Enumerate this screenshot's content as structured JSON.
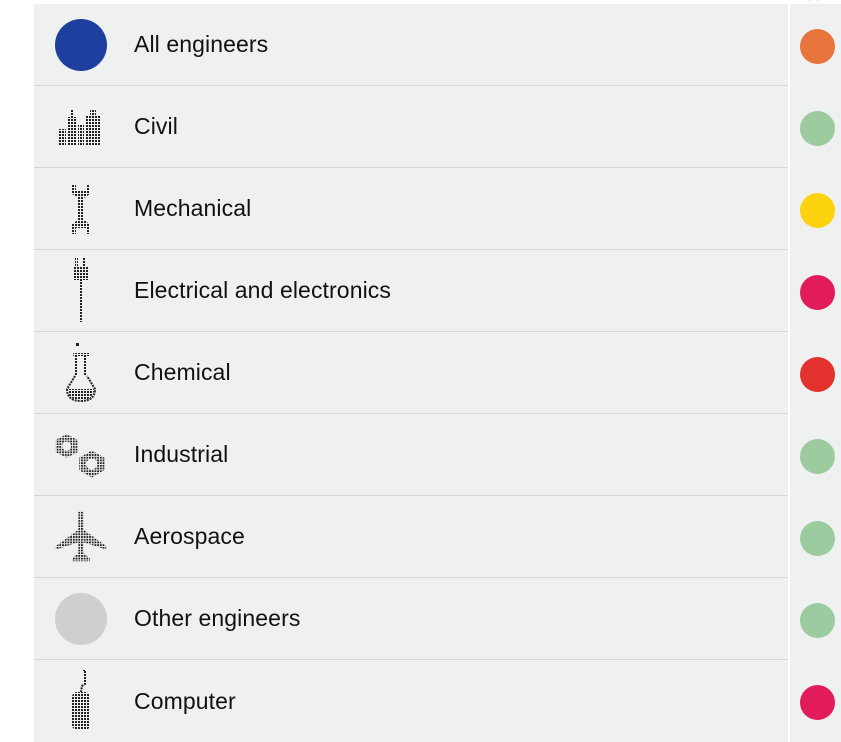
{
  "close_icon_glyph": "✕",
  "rows": [
    {
      "label": "All engineers",
      "icon": "blue-dot-icon",
      "indicator_color": "#e8743b"
    },
    {
      "label": "Civil",
      "icon": "buildings-icon",
      "indicator_color": "#9bcb9f"
    },
    {
      "label": "Mechanical",
      "icon": "wrench-icon",
      "indicator_color": "#fdd20e"
    },
    {
      "label": "Electrical and electronics",
      "icon": "plug-icon",
      "indicator_color": "#e21c5a"
    },
    {
      "label": "Chemical",
      "icon": "flask-icon",
      "indicator_color": "#e3312d"
    },
    {
      "label": "Industrial",
      "icon": "gears-icon",
      "indicator_color": "#9bcb9f"
    },
    {
      "label": "Aerospace",
      "icon": "airplane-icon",
      "indicator_color": "#9bcb9f"
    },
    {
      "label": "Other engineers",
      "icon": "gray-dot-icon",
      "indicator_color": "#9bcb9f"
    },
    {
      "label": "Computer",
      "icon": "computer-mouse-icon",
      "indicator_color": "#e21c5a"
    }
  ],
  "colors": {
    "all_engineers_dot": "#1e3f9e",
    "other_engineers_dot": "#cfcfcf",
    "panel_background": "#eff0f0",
    "divider": "#d6d7d7"
  }
}
